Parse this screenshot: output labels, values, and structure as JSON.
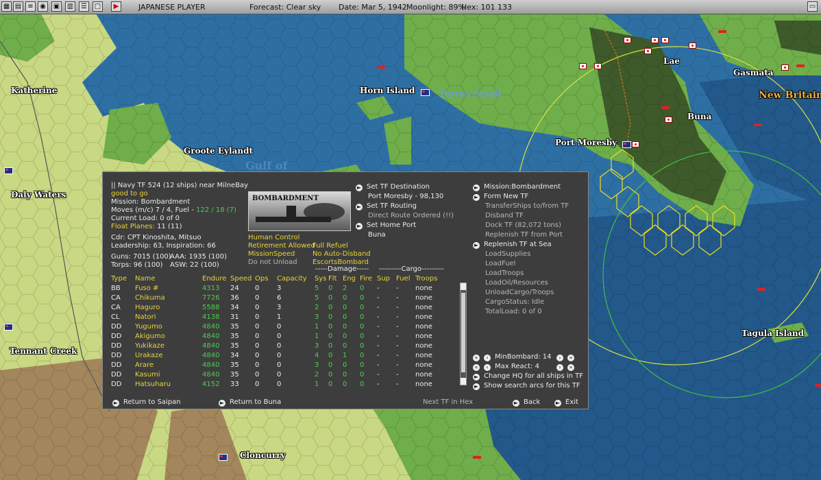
{
  "topbar": {
    "player": "JAPANESE PLAYER",
    "forecast": "Forecast: Clear sky",
    "date": "Date: Mar 5, 1942",
    "moonlight": "Moonlight: 89%",
    "hex": "Hex: 101 133",
    "icons": [
      "map-icon",
      "grid-icon",
      "globe-icon",
      "info-icon",
      "report-icon",
      "list-icon",
      "window-icon",
      "play-icon",
      "menu-icon"
    ]
  },
  "map": {
    "labels": {
      "katherine": "Katherine",
      "horn_island": "Horn Island",
      "torres_strait": "Torres Strait",
      "groote": "Groote Eylandt",
      "gulf": "Gulf of",
      "daly": "Daly Waters",
      "tennant": "Tennant Creek",
      "cloncurry": "Cloncurry",
      "port_moresby": "Port Moresby",
      "buna": "Buna",
      "lae": "Lae",
      "gasmata": "Gasmata",
      "new_britain": "New Britain",
      "tagula": "Tagula Island"
    },
    "colors": {
      "sea": "#2e6fa3",
      "deep": "#23588a",
      "land": "#c9d882",
      "green": "#6fae4a",
      "desert": "#a4865c",
      "jungle": "#3e5a2a"
    }
  },
  "panel": {
    "tf_header": "|| Navy TF 524 (12 ships)  near MilneBay",
    "status": "good to go",
    "mission": "Mission: Bombardment",
    "moves_prefix": "Moves (m/c) 7 / 4, Fuel - ",
    "moves_fuel": "122 / 18 (7)",
    "current_load": "Current Load: 0 of 0",
    "float_planes_label": "Float Planes:",
    "float_planes": " 11 (11)",
    "cdr": "Cdr: CPT Kinoshita, Mitsuo",
    "leadership": "Leadership: 63, Inspiration: 66",
    "guns": "Guns: 7015 (100)",
    "aaa": "AAA: 1935 (100)",
    "torps": "Torps: 96 (100)",
    "asw": "ASW: 22 (100)",
    "picture_caption": "BOMBARDMENT",
    "opt1": "Human Control",
    "opt2": "Retirement Allowed",
    "opt3": "MissionSpeed",
    "opt4": "Do not Unload",
    "opt5": "Full Refuel",
    "opt6": "No Auto-Disband",
    "opt7": "EscortsBombard",
    "mid_actions": {
      "set_dest": "Set TF Destination",
      "dest_value": "Port Moresby - 98,130",
      "set_routing": "Set TF Routing",
      "direct_route": "Direct Route Ordered (!!)",
      "set_home": "Set Home Port",
      "home_value": "Buna"
    },
    "right_actions": {
      "mission": "Mission:Bombardment",
      "form_new": "Form New TF",
      "transfer": "TransferShips to/from TF",
      "disband": "Disband TF",
      "dock": "Dock TF (82,072 tons)",
      "replenish_port": "Replenish TF from Port",
      "replenish_sea": "Replenish TF at Sea",
      "load_supplies": "LoadSupplies",
      "load_fuel": "LoadFuel",
      "load_troops": "LoadTroops",
      "load_oil": "LoadOil/Resources",
      "unload": "UnloadCargo/Troops",
      "cargo_status": "CargoStatus: Idle",
      "total_load": "TotalLoad: 0 of 0",
      "min_bombard": "MinBombard:  14",
      "max_react": "Max React:  4",
      "change_hq": "Change HQ for all ships in TF",
      "show_search": "Show search arcs for this TF"
    },
    "damage_header": "-----Damage-----",
    "cargo_header": "---------Cargo---------",
    "columns": [
      "Type",
      "Name",
      "Endure",
      "Speed",
      "Ops",
      "Capacity",
      "Sys",
      "Flt",
      "Eng",
      "Fire",
      "Sup",
      "Fuel",
      "Troops"
    ],
    "ships": [
      [
        "BB",
        "Fuso #",
        "4313",
        "24",
        "0",
        "3",
        "5",
        "0",
        "2",
        "0",
        "-",
        "-",
        "none"
      ],
      [
        "CA",
        "Chikuma",
        "7726",
        "36",
        "0",
        "6",
        "5",
        "0",
        "0",
        "0",
        "-",
        "-",
        "none"
      ],
      [
        "CA",
        "Haguro",
        "5588",
        "34",
        "0",
        "3",
        "2",
        "0",
        "0",
        "0",
        "-",
        "-",
        "none"
      ],
      [
        "CL",
        "Natori",
        "4138",
        "31",
        "0",
        "1",
        "3",
        "0",
        "0",
        "0",
        "-",
        "-",
        "none"
      ],
      [
        "DD",
        "Yugumo",
        "4840",
        "35",
        "0",
        "0",
        "1",
        "0",
        "0",
        "0",
        "-",
        "-",
        "none"
      ],
      [
        "DD",
        "Akigumo",
        "4840",
        "35",
        "0",
        "0",
        "1",
        "0",
        "0",
        "0",
        "-",
        "-",
        "none"
      ],
      [
        "DD",
        "Yukikaze",
        "4840",
        "35",
        "0",
        "0",
        "3",
        "0",
        "0",
        "0",
        "-",
        "-",
        "none"
      ],
      [
        "DD",
        "Urakaze",
        "4840",
        "34",
        "0",
        "0",
        "4",
        "0",
        "1",
        "0",
        "-",
        "-",
        "none"
      ],
      [
        "DD",
        "Arare",
        "4840",
        "35",
        "0",
        "0",
        "3",
        "0",
        "0",
        "0",
        "-",
        "-",
        "none"
      ],
      [
        "DD",
        "Kasumi",
        "4840",
        "35",
        "0",
        "0",
        "2",
        "0",
        "0",
        "0",
        "-",
        "-",
        "none"
      ],
      [
        "DD",
        "Hatsuharu",
        "4152",
        "33",
        "0",
        "0",
        "1",
        "0",
        "0",
        "0",
        "-",
        "-",
        "none"
      ]
    ],
    "bottom": {
      "return_saipan": "Return to Saipan",
      "return_buna": "Return to Buna",
      "next_tf": "Next TF in Hex",
      "back": "Back",
      "exit": "Exit"
    }
  }
}
